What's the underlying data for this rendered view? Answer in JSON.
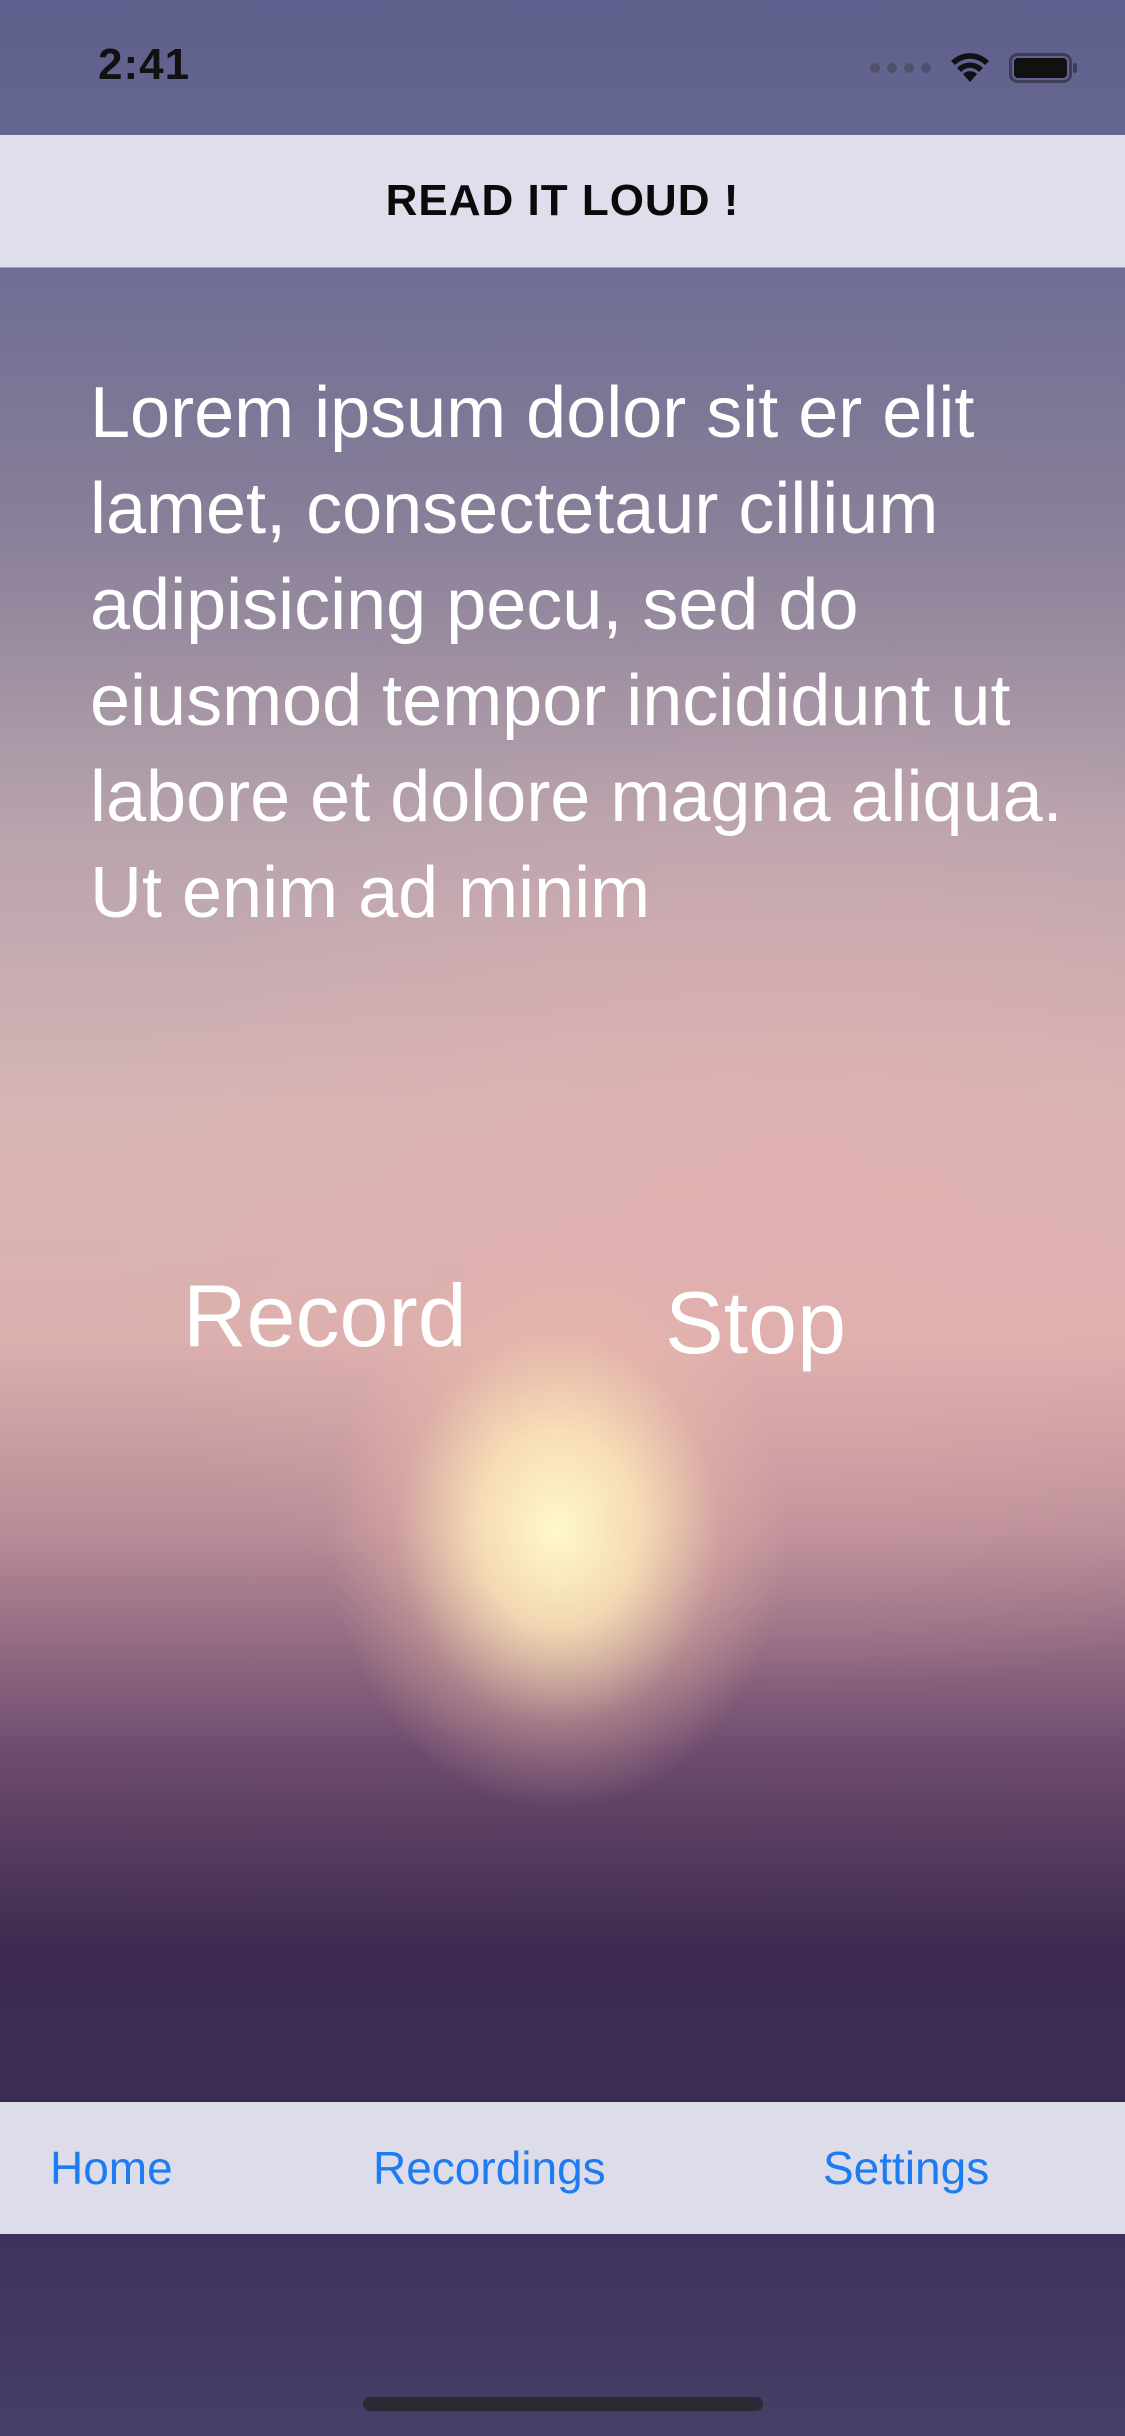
{
  "status_bar": {
    "time": "2:41",
    "icons": [
      "signal-dots-icon",
      "wifi-icon",
      "battery-icon"
    ]
  },
  "nav_bar": {
    "title": "READ IT LOUD !"
  },
  "content": {
    "text": "Lorem ipsum dolor sit er elit lamet, consectetaur cillium adipisicing pecu, sed do eiusmod tempor incididunt ut labore et dolore magna aliqua. Ut enim ad minim"
  },
  "actions": {
    "record_label": "Record",
    "stop_label": "Stop"
  },
  "tab_bar": {
    "items": [
      {
        "label": "Home"
      },
      {
        "label": "Recordings"
      },
      {
        "label": "Settings"
      }
    ]
  },
  "colors": {
    "tint": "#1d7cf2",
    "bar_background": "#e2e2ee",
    "text_light": "#ffffff"
  }
}
